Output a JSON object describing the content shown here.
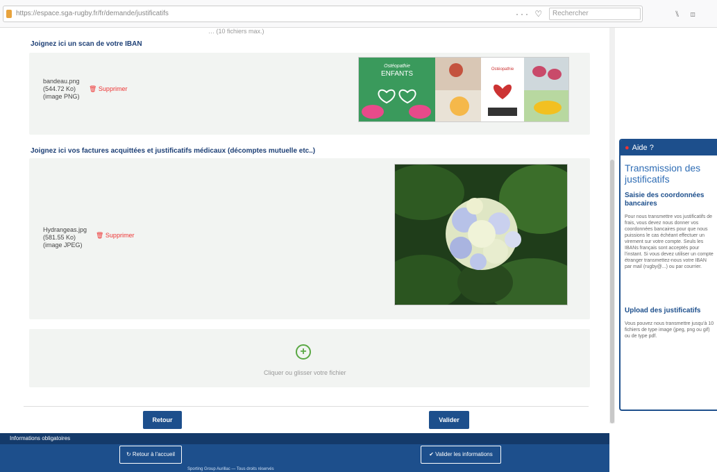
{
  "browser": {
    "url": "https://espace.sga-rugby.fr/fr/demande/justificatifs",
    "search_placeholder": "Rechercher",
    "actions": "··· ♡ ☆",
    "toolbar_icons": "⑊ ◫"
  },
  "top_cut_text": "… (10 fichiers max.)",
  "iban": {
    "label": "Joignez ici un scan de votre IBAN",
    "file_name": "bandeau.png",
    "file_size": "(544.72 Ko)",
    "file_type": "(image PNG)",
    "delete_label": "🗑 Supprimer",
    "thumb_caption_1": "Ostéopathie",
    "thumb_caption_2": "ENFANTS",
    "thumb_caption_3": "Ostéopathie"
  },
  "invoices": {
    "label": "Joignez ici vos factures acquittées et justificatifs médicaux (décomptes mutuelle etc..)",
    "file_name": "Hydrangeas.jpg",
    "file_size": "(581.55 Ko)",
    "file_type": "(image JPEG)",
    "delete_label": "🗑 Supprimer"
  },
  "dropzone": {
    "add_symbol": "+",
    "text": "Cliquer ou glisser votre fichier"
  },
  "buttons": {
    "back": "Retour",
    "submit": "Valider"
  },
  "footer": {
    "required_info": "Informations obligatoires",
    "home_button": "↻ Retour à l'accueil",
    "validate_button": "✔ Valider les informations",
    "copyright": "Sporting Group Aurillac — Tous droits réservés"
  },
  "help": {
    "header": "Aide ?",
    "title": "Transmission des justificatifs",
    "sub1": "Saisie des coordonnées bancaires",
    "text1": "Pour nous transmettre vos justificatifs de frais, vous devez nous donner vos coordonnées bancaires pour que nous puissions le cas échéant effectuer un virement sur votre compte. Seuls les IBANs français sont acceptés pour l'instant. Si vous devez utiliser un compte étranger transmettez-nous votre IBAN par mail (rugby@...) ou par courrier.",
    "sub2": "Upload des justificatifs",
    "text2": "Vous pouvez nous transmettre jusqu'à 10 fichiers de type image (jpeg, png ou gif) ou de type pdf."
  }
}
